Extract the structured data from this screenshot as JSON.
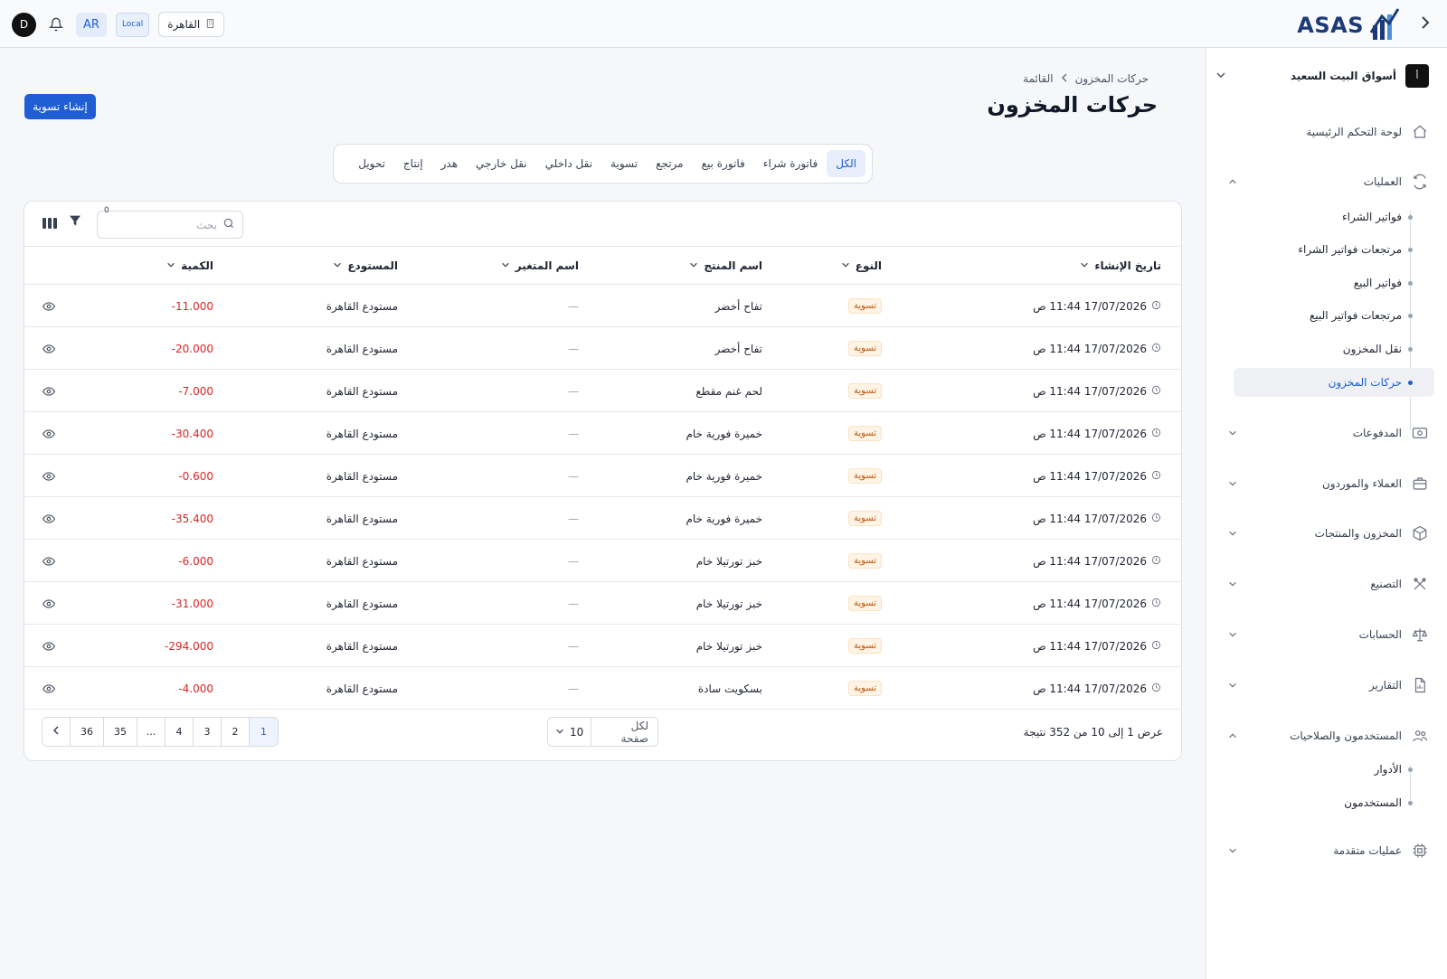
{
  "topbar": {
    "avatar_letter": "D",
    "lang": "AR",
    "env": "Local",
    "branch": "القاهرة",
    "logo": "ASAS"
  },
  "sidebar": {
    "org_name": "أسواق البيت السعيد",
    "org_initial": "أ",
    "dashboard": "لوحة التحكم الرئيسية",
    "operations": "العمليات",
    "operations_items": [
      "فواتير الشراء",
      "مرتجعات فواتير الشراء",
      "فواتير البيع",
      "مرتجعات فواتير البيع",
      "نقل المخزون",
      "حركات المخزون"
    ],
    "payments": "المدفوعات",
    "clients": "العملاء والموردون",
    "inventory": "المخزون والمنتجات",
    "manufacturing": "التصنيع",
    "accounts": "الحسابات",
    "reports": "التقارير",
    "users_perms": "المستخدمون والصلاحيات",
    "users_items": [
      "الأدوار",
      "المستخدمون"
    ],
    "advanced": "عمليات متقدمة"
  },
  "breadcrumb": {
    "first": "حركات المخزون",
    "second": "القائمة"
  },
  "page_title": "حركات المخزون",
  "create_button": "إنشاء تسوية",
  "tabs": [
    "الكل",
    "فاتورة شراء",
    "فاتورة بيع",
    "مرتجع",
    "تسوية",
    "نقل داخلي",
    "نقل خارجي",
    "هدر",
    "إنتاج",
    "تحويل"
  ],
  "search_placeholder": "بحث",
  "filter_count": "0",
  "columns": {
    "date": "تاريخ الإنشاء",
    "type": "النوع",
    "product": "اسم المنتج",
    "variant": "اسم المتغير",
    "warehouse": "المستودع",
    "quantity": "الكمية"
  },
  "rows": [
    {
      "date": "17/07/2026 11:44 ص",
      "type": "تسوية",
      "product": "تفاح أخضر",
      "variant": "—",
      "warehouse": "مستودع القاهرة",
      "qty": "-11.000"
    },
    {
      "date": "17/07/2026 11:44 ص",
      "type": "تسوية",
      "product": "تفاح أخضر",
      "variant": "—",
      "warehouse": "مستودع القاهرة",
      "qty": "-20.000"
    },
    {
      "date": "17/07/2026 11:44 ص",
      "type": "تسوية",
      "product": "لحم غنم مقطع",
      "variant": "—",
      "warehouse": "مستودع القاهرة",
      "qty": "-7.000"
    },
    {
      "date": "17/07/2026 11:44 ص",
      "type": "تسوية",
      "product": "خميرة فورية خام",
      "variant": "—",
      "warehouse": "مستودع القاهرة",
      "qty": "-30.400"
    },
    {
      "date": "17/07/2026 11:44 ص",
      "type": "تسوية",
      "product": "خميرة فورية خام",
      "variant": "—",
      "warehouse": "مستودع القاهرة",
      "qty": "-0.600"
    },
    {
      "date": "17/07/2026 11:44 ص",
      "type": "تسوية",
      "product": "خميرة فورية خام",
      "variant": "—",
      "warehouse": "مستودع القاهرة",
      "qty": "-35.400"
    },
    {
      "date": "17/07/2026 11:44 ص",
      "type": "تسوية",
      "product": "خبز تورتيلا خام",
      "variant": "—",
      "warehouse": "مستودع القاهرة",
      "qty": "-6.000"
    },
    {
      "date": "17/07/2026 11:44 ص",
      "type": "تسوية",
      "product": "خبز تورتيلا خام",
      "variant": "—",
      "warehouse": "مستودع القاهرة",
      "qty": "-31.000"
    },
    {
      "date": "17/07/2026 11:44 ص",
      "type": "تسوية",
      "product": "خبز تورتيلا خام",
      "variant": "—",
      "warehouse": "مستودع القاهرة",
      "qty": "-294.000"
    },
    {
      "date": "17/07/2026 11:44 ص",
      "type": "تسوية",
      "product": "بسكويت سادة",
      "variant": "—",
      "warehouse": "مستودع القاهرة",
      "qty": "-4.000"
    }
  ],
  "footer": {
    "summary": "عرض 1 إلى 10 من 352 نتيجة",
    "per_page_label": "لكل صفحة",
    "per_page_value": "10",
    "pages": [
      "1",
      "2",
      "3",
      "4",
      "...",
      "35",
      "36"
    ]
  },
  "colors": {
    "accent": "#1f5ed4",
    "negative": "#dc2626",
    "badge": "#c0560d"
  }
}
